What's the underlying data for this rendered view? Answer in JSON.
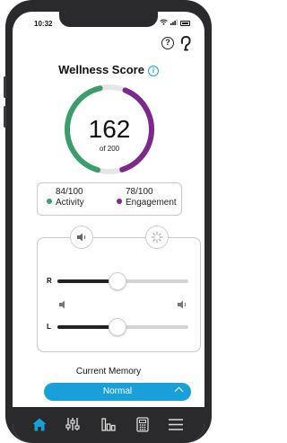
{
  "status_bar": {
    "time": "10:32"
  },
  "header": {
    "help_icon": "question-circle",
    "ear_icon": "ear"
  },
  "title": "Wellness Score",
  "score": {
    "value": "162",
    "max_label": "of 200",
    "activity_fraction": 0.84,
    "engagement_fraction": 0.78
  },
  "stats": {
    "activity": {
      "value": "84/100",
      "label": "Activity",
      "color": "#3a9d6a"
    },
    "engagement": {
      "value": "78/100",
      "label": "Engagement",
      "color": "#7b2a8c"
    }
  },
  "sound": {
    "mode_left_icon": "speaker-icon",
    "mode_right_icon": "sparkle-icon",
    "right_label": "R",
    "left_label": "L",
    "right_level": 0.46,
    "left_level": 0.46
  },
  "memory": {
    "label": "Current Memory",
    "selected": "Normal"
  },
  "colors": {
    "accent": "#1aa0d8",
    "frame": "#2a2a2c"
  },
  "tabs": [
    "home-icon",
    "adjust-icon",
    "stats-icon",
    "remote-icon",
    "menu-icon"
  ]
}
